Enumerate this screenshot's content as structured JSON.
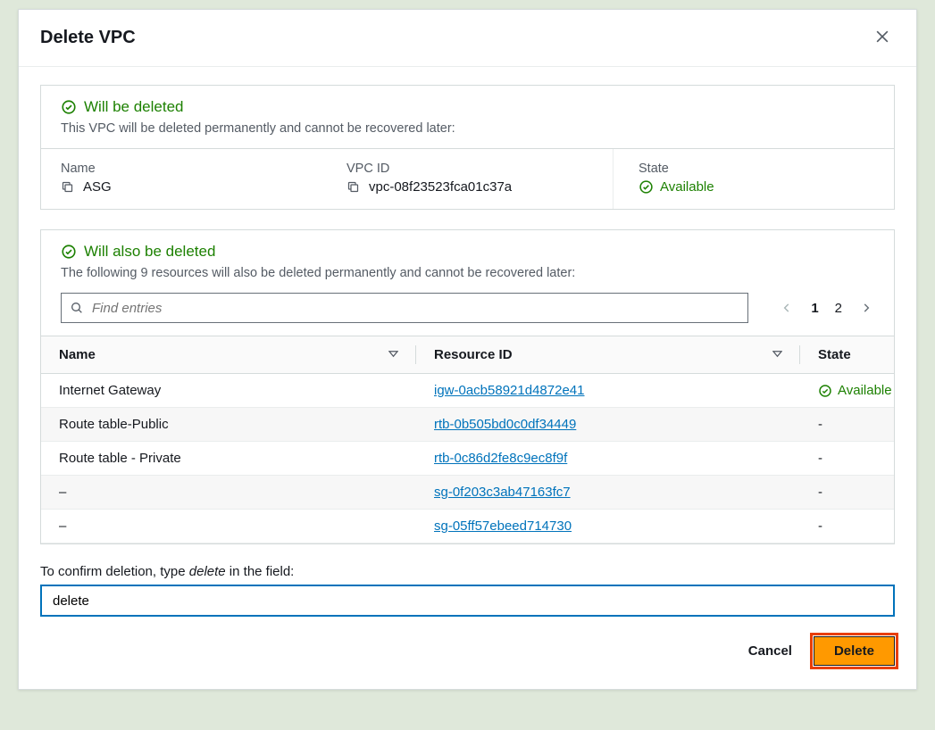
{
  "modal": {
    "title": "Delete VPC"
  },
  "section1": {
    "status": "Will be deleted",
    "hint": "This VPC will be deleted permanently and cannot be recovered later:",
    "name_label": "Name",
    "name_value": "ASG",
    "vpcid_label": "VPC ID",
    "vpcid_value": "vpc-08f23523fca01c37a",
    "state_label": "State",
    "state_value": "Available"
  },
  "section2": {
    "status": "Will also be deleted",
    "hint": "The following 9 resources will also be deleted permanently and cannot be recovered later:",
    "search_placeholder": "Find entries",
    "page1": "1",
    "page2": "2",
    "columns": {
      "name": "Name",
      "resource_id": "Resource ID",
      "state": "State"
    },
    "rows": [
      {
        "name": "Internet Gateway",
        "rid": "igw-0acb58921d4872e41",
        "state": "Available"
      },
      {
        "name": "Route table-Public",
        "rid": "rtb-0b505bd0c0df34449",
        "state": "-"
      },
      {
        "name": "Route table - Private",
        "rid": "rtb-0c86d2fe8c9ec8f9f",
        "state": "-"
      },
      {
        "name": "–",
        "rid": "sg-0f203c3ab47163fc7",
        "state": "-"
      },
      {
        "name": "–",
        "rid": "sg-05ff57ebeed714730",
        "state": "-"
      }
    ]
  },
  "confirm": {
    "label_pre": "To confirm deletion, type ",
    "label_word": "delete",
    "label_post": " in the field:",
    "value": "delete"
  },
  "footer": {
    "cancel": "Cancel",
    "delete": "Delete"
  }
}
